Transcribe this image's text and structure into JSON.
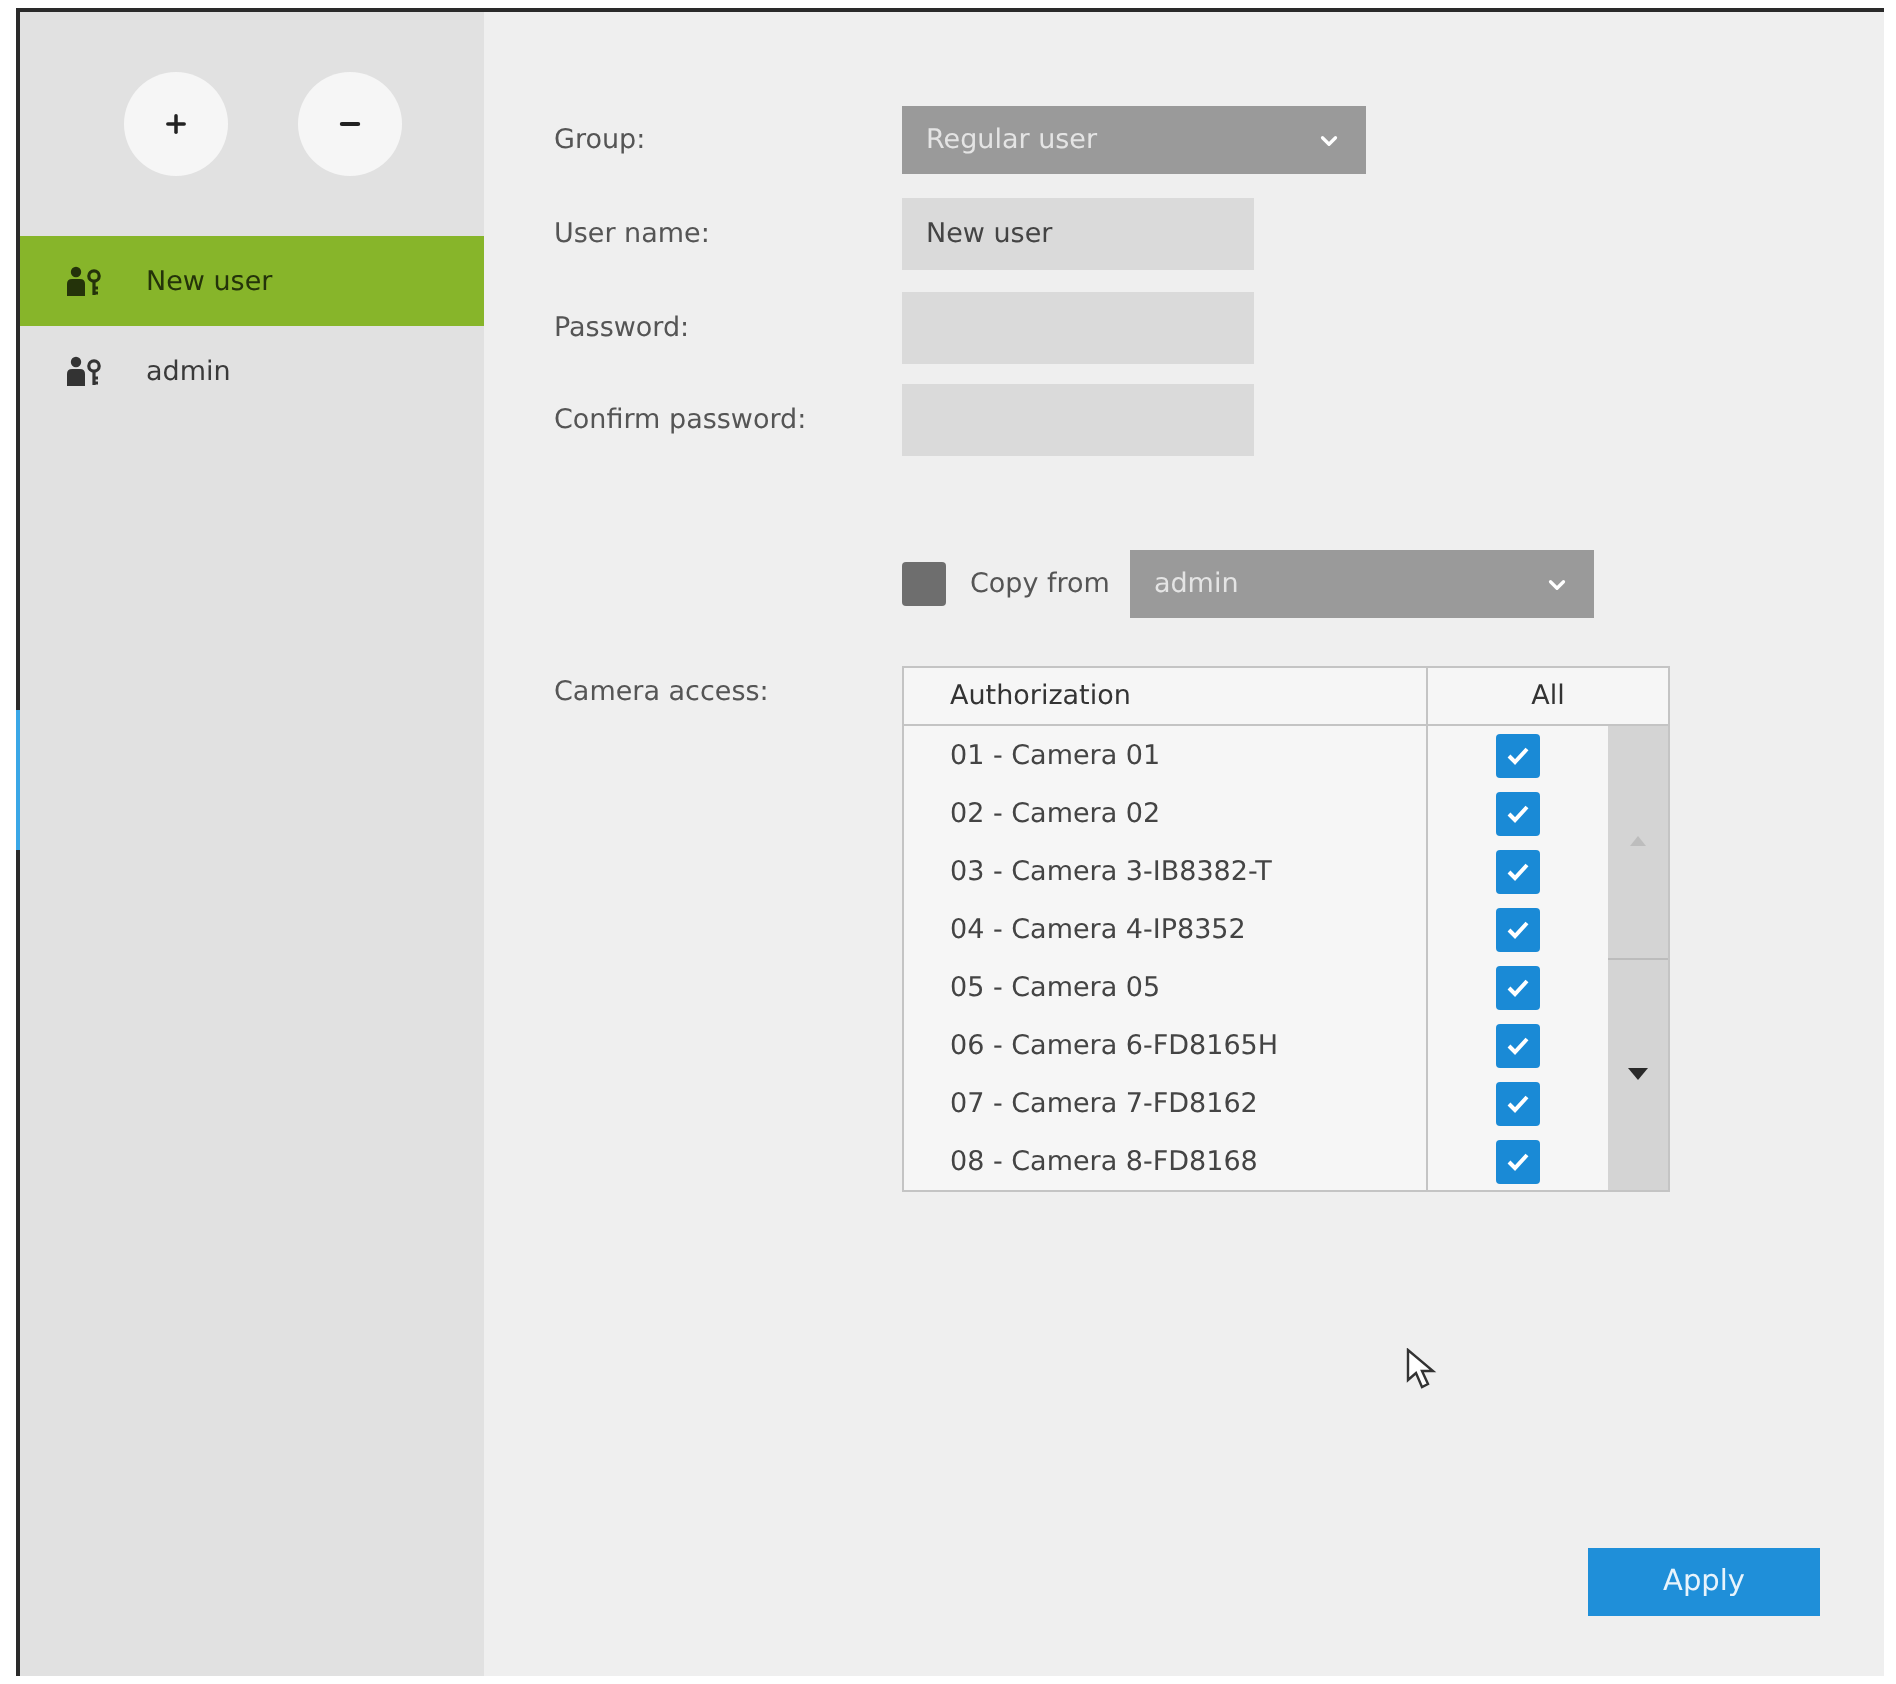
{
  "sidebar": {
    "users": [
      {
        "name": "New user",
        "selected": true
      },
      {
        "name": "admin",
        "selected": false
      }
    ]
  },
  "form": {
    "fields": [
      {
        "kind": "select",
        "label": "Group:",
        "value": "Regular user"
      },
      {
        "kind": "text",
        "label": "User name:",
        "value": "New user"
      },
      {
        "kind": "password",
        "label": "Password:"
      },
      {
        "kind": "password",
        "label": "Confirm password:"
      }
    ]
  },
  "copy_from": {
    "label": "Copy from",
    "checked": false,
    "value": "admin"
  },
  "camera_access": {
    "label": "Camera access:",
    "columns": [
      "Authorization",
      "All"
    ],
    "rows": [
      {
        "name": "01 - Camera 01",
        "checked": true
      },
      {
        "name": "02 - Camera 02",
        "checked": true
      },
      {
        "name": "03 - Camera 3-IB8382-T",
        "checked": true
      },
      {
        "name": "04 - Camera 4-IP8352",
        "checked": true
      },
      {
        "name": "05 - Camera 05",
        "checked": true
      },
      {
        "name": "06 - Camera 6-FD8165H",
        "checked": true
      },
      {
        "name": "07 - Camera 7-FD8162",
        "checked": true
      },
      {
        "name": "08 - Camera 8-FD8168",
        "checked": true
      }
    ]
  },
  "apply_button": {
    "label": "Apply"
  }
}
